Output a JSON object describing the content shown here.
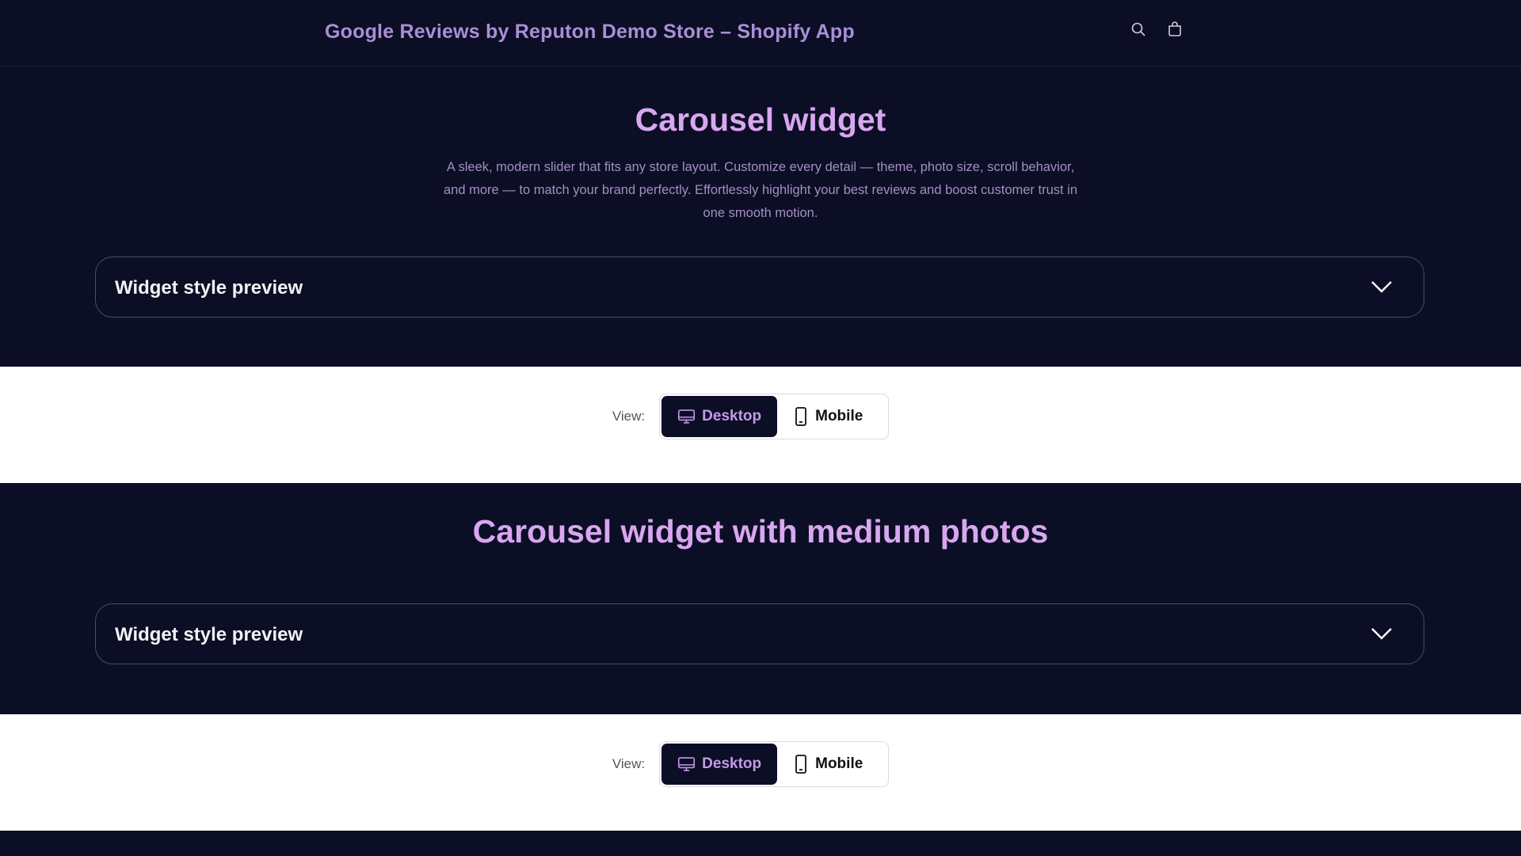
{
  "header": {
    "store_title": "Google Reviews by Reputon Demo Store – Shopify App",
    "icons": [
      "search-icon",
      "cart-icon"
    ]
  },
  "sections": [
    {
      "heading": "Carousel widget",
      "description": "A sleek, modern slider that fits any store layout. Customize every detail — theme, photo size, scroll behavior, and more — to match your brand perfectly. Effortlessly highlight your best reviews and boost customer trust in one smooth motion.",
      "accordion_label": "Widget style preview",
      "view_label": "View:",
      "desktop_label": "Desktop",
      "mobile_label": "Mobile",
      "selected_view": "Desktop"
    },
    {
      "heading": "Carousel widget with medium photos",
      "accordion_label": "Widget style preview",
      "view_label": "View:",
      "desktop_label": "Desktop",
      "mobile_label": "Mobile",
      "selected_view": "Desktop"
    }
  ],
  "colors": {
    "dark_bg": "#0b0e24",
    "heading_accent": "#d9a6f0",
    "title_accent": "#a98fd6"
  }
}
